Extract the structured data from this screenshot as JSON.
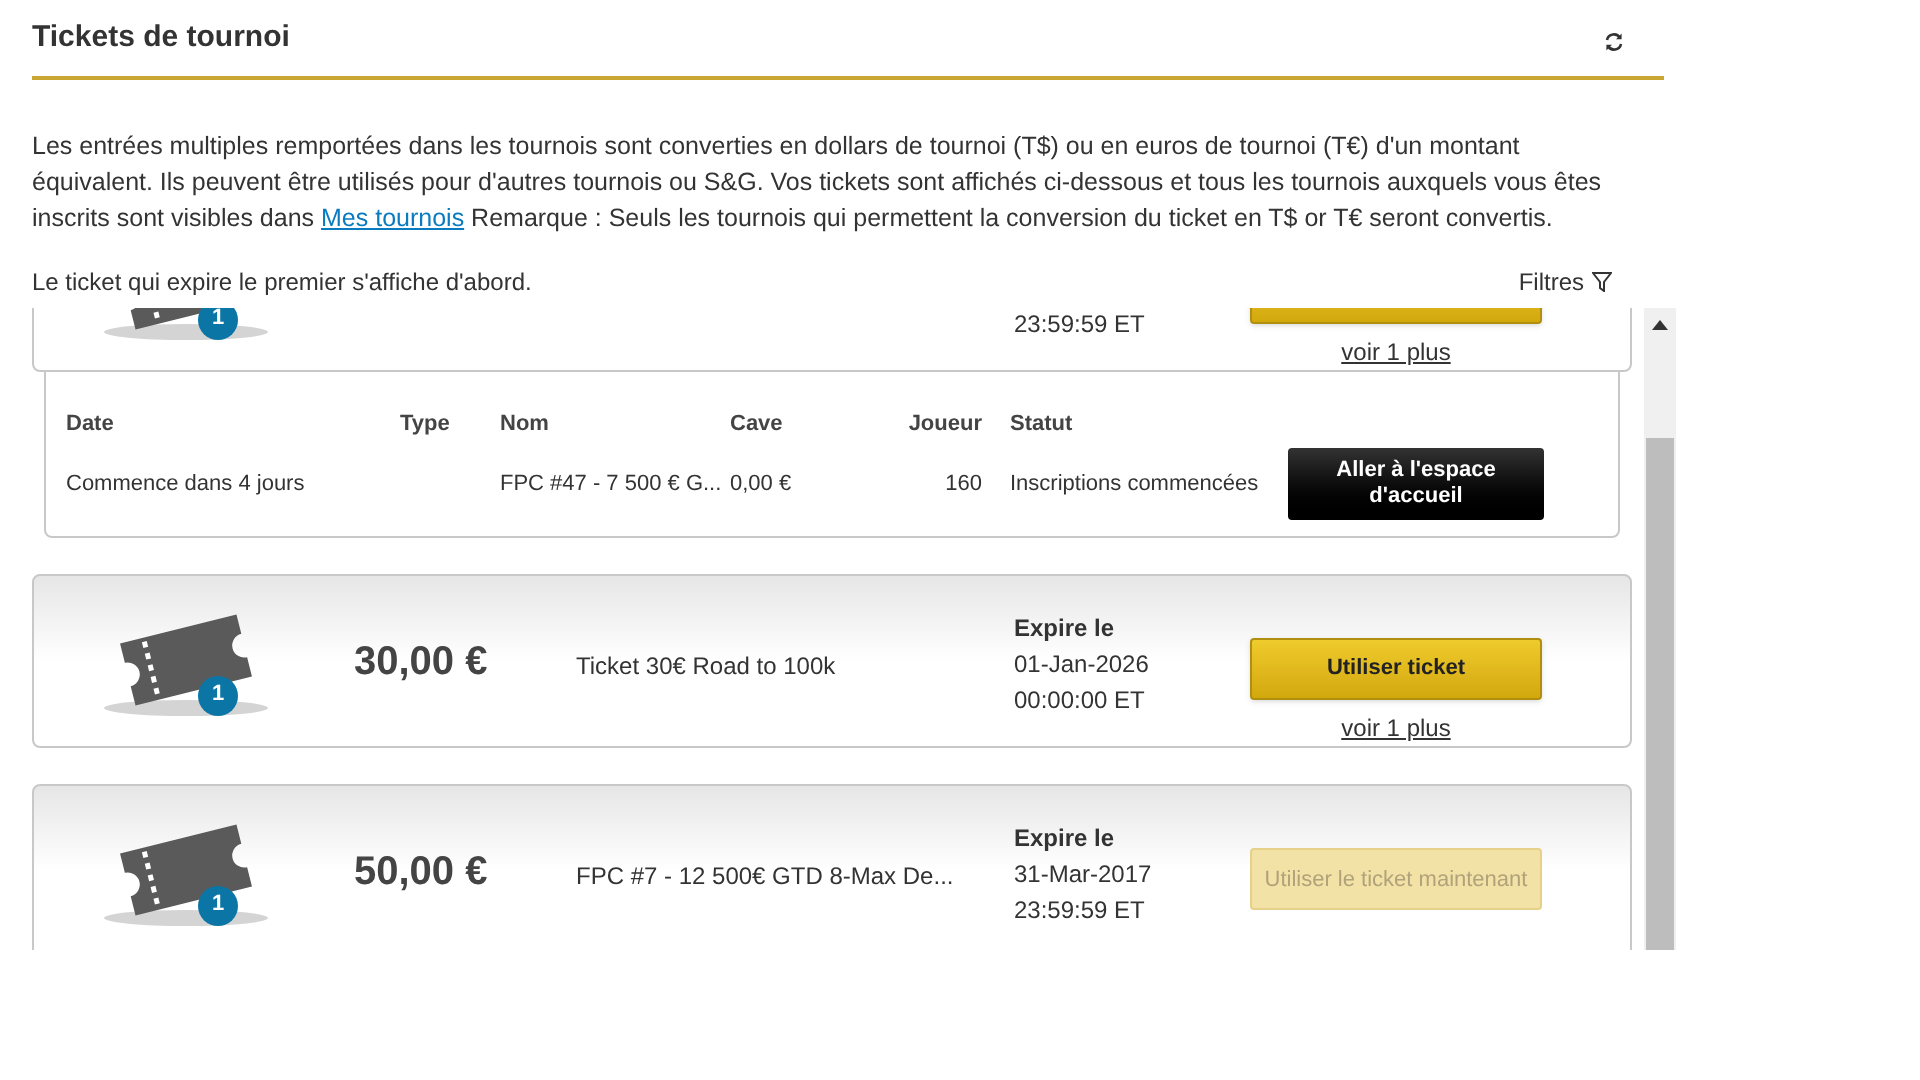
{
  "header": {
    "title": "Tickets de tournoi"
  },
  "intro": {
    "text_before": "Les entrées multiples remportées dans les tournois sont converties en dollars de tournoi (T$) ou en euros de tournoi (T€) d'un montant équivalent. Ils peuvent être utilisés pour d'autres tournois ou S&G. Vos tickets sont affichés ci-dessous et tous les tournois auxquels vous êtes inscrits sont visibles dans",
    "link": "Mes tournois",
    "text_after": "Remarque : Seuls les tournois qui permettent la conversion du ticket en T$ or T€ seront convertis."
  },
  "sort_note": "Le ticket qui expire le premier s'affiche d'abord.",
  "filter_label": "Filtres",
  "tickets": [
    {
      "badge": "1",
      "expiry_time": "23:59:59 ET",
      "button": {
        "disabled": false
      },
      "more_link": "voir 1 plus",
      "details": {
        "columns": [
          "Date",
          "Type",
          "Nom",
          "Cave",
          "Joueur",
          "Statut"
        ],
        "row": {
          "date": "Commence dans 4 jours",
          "name": "FPC #47 - 7 500 € G...",
          "buy_in": "0,00 €",
          "players": "160",
          "status": "Inscriptions commencées"
        },
        "action": "Aller à l'espace d'accueil"
      }
    },
    {
      "badge": "1",
      "amount": "30,00 €",
      "name": "Ticket 30€ Road to 100k",
      "expiry_label": "Expire le",
      "expiry_date": "01-Jan-2026",
      "expiry_time": "00:00:00 ET",
      "button": {
        "label": "Utiliser ticket",
        "disabled": false
      },
      "more_link": "voir 1 plus"
    },
    {
      "badge": "1",
      "amount": "50,00 €",
      "name": "FPC #7 - 12 500€ GTD 8-Max De...",
      "expiry_label": "Expire le",
      "expiry_date": "31-Mar-2017",
      "expiry_time": "23:59:59 ET",
      "button": {
        "label": "Utiliser le ticket maintenant",
        "disabled": true
      }
    }
  ]
}
